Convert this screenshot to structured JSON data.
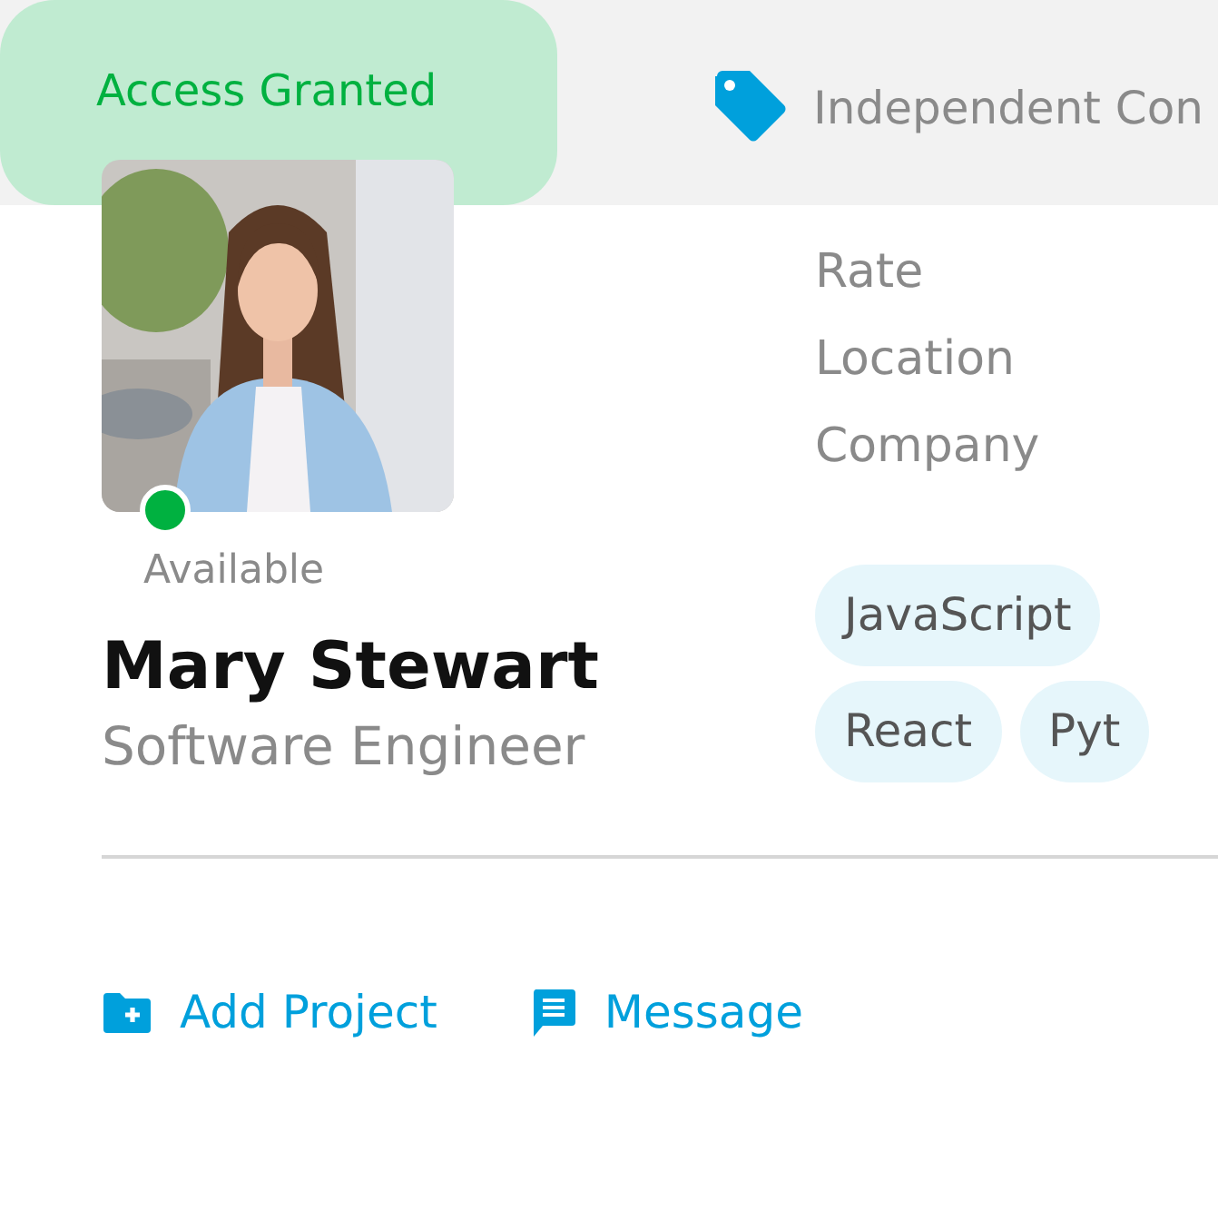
{
  "access": {
    "label": "Access Granted",
    "granted": true
  },
  "category": {
    "label": "Independent Con"
  },
  "profile": {
    "available": true,
    "status": "Available",
    "name": "Mary Stewart",
    "title": "Software Engineer"
  },
  "details": [
    "Rate",
    "Location",
    "Company"
  ],
  "skill_rows": [
    [
      "JavaScript"
    ],
    [
      "React",
      "Pyt"
    ]
  ],
  "actions": [
    {
      "kind": "add-project",
      "label": "Add Project"
    },
    {
      "kind": "message",
      "label": "Message"
    }
  ]
}
